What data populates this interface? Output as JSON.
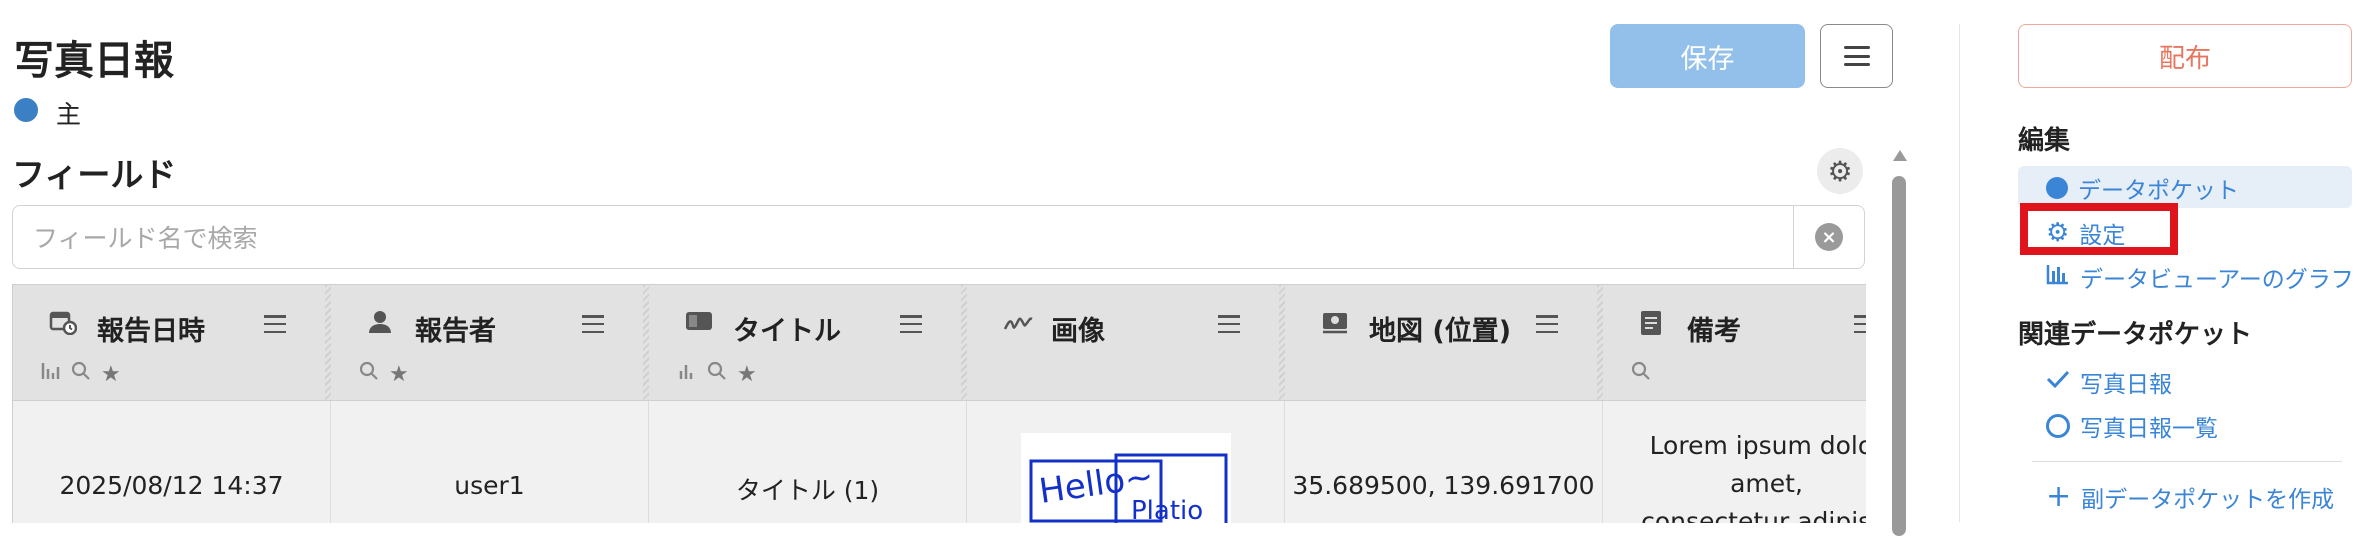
{
  "header": {
    "title": "写真日報",
    "role_label": "主",
    "save_label": "保存",
    "fields_heading": "フィールド"
  },
  "search": {
    "placeholder": "フィールド名で検索",
    "value": ""
  },
  "table": {
    "columns": [
      {
        "title": "報告日時",
        "icon": "calendar-clock-icon"
      },
      {
        "title": "報告者",
        "icon": "person-icon"
      },
      {
        "title": "タイトル",
        "icon": "text-field-icon"
      },
      {
        "title": "画像",
        "icon": "signature-icon"
      },
      {
        "title": "地図 (位置)",
        "icon": "map-location-icon"
      },
      {
        "title": "備考",
        "icon": "document-icon"
      }
    ],
    "row": {
      "date": "2025/08/12 14:37",
      "reporter": "user1",
      "title": "タイトル (1)",
      "image_text": "Hello~ Platio",
      "location": "35.689500, 139.691700",
      "notes_line1": "Lorem ipsum dolor",
      "notes_line2": "amet,",
      "notes_line3": "consectetur adipisci"
    }
  },
  "sidebar": {
    "publish_label": "配布",
    "edit_heading": "編集",
    "items": [
      {
        "label": "データポケット",
        "icon": "circle-icon",
        "active": true
      },
      {
        "label": "設定",
        "icon": "gear-icon"
      },
      {
        "label": "データビューアーのグラフ",
        "icon": "bar-chart-icon"
      }
    ],
    "related_heading": "関連データポケット",
    "related": [
      {
        "label": "写真日報",
        "icon": "check-icon"
      },
      {
        "label": "写真日報一覧",
        "icon": "ring-icon"
      }
    ],
    "create_label": "副データポケットを作成"
  },
  "colors": {
    "accent": "#3b85d6",
    "save_disabled": "#93c0ea",
    "publish": "#e8765f",
    "highlight": "#e0141c"
  }
}
